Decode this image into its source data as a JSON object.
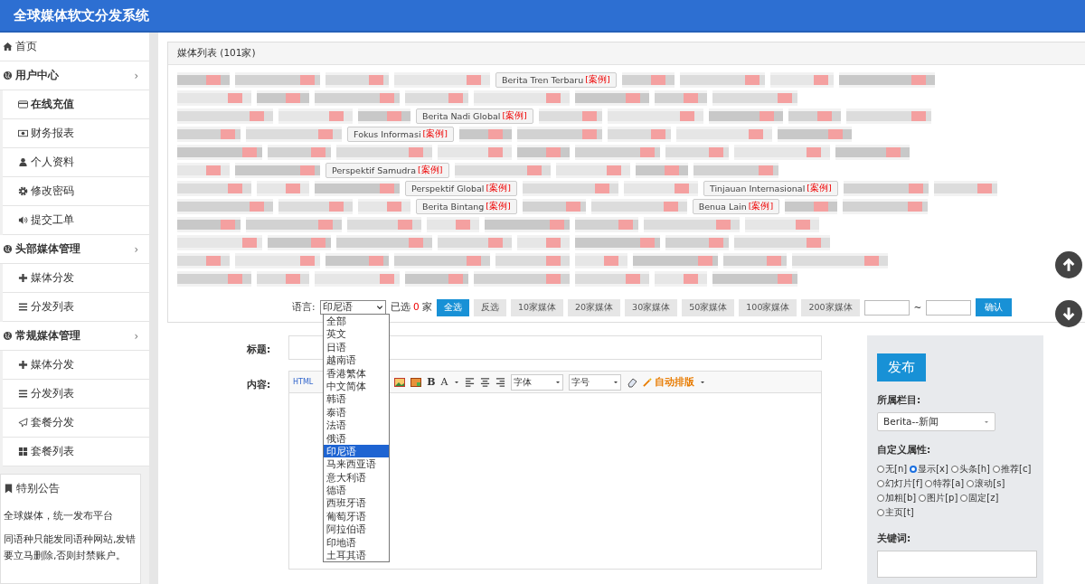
{
  "header": {
    "title": "全球媒体软文分发系统"
  },
  "sidebar": {
    "items": [
      {
        "kind": "top",
        "label": "首页"
      },
      {
        "kind": "group",
        "label": "用户中心",
        "chevron": "›"
      },
      {
        "kind": "sub",
        "label": "在线充值",
        "selected": true
      },
      {
        "kind": "sub",
        "label": "财务报表",
        "selected": false
      },
      {
        "kind": "sub",
        "label": "个人资料",
        "selected": false
      },
      {
        "kind": "sub",
        "label": "修改密码",
        "selected": false
      },
      {
        "kind": "sub",
        "label": "提交工单",
        "selected": false
      },
      {
        "kind": "group",
        "label": "头部媒体管理",
        "chevron": "›"
      },
      {
        "kind": "sub",
        "label": "媒体分发",
        "selected": false
      },
      {
        "kind": "sub",
        "label": "分发列表",
        "selected": false
      },
      {
        "kind": "group",
        "label": "常规媒体管理",
        "chevron": "›"
      },
      {
        "kind": "sub",
        "label": "媒体分发",
        "selected": false
      },
      {
        "kind": "sub",
        "label": "分发列表",
        "selected": false
      },
      {
        "kind": "sub",
        "label": "套餐分发",
        "selected": false
      },
      {
        "kind": "sub",
        "label": "套餐列表",
        "selected": false
      }
    ],
    "notice": {
      "title": "特别公告",
      "lines": [
        "全球媒体，统一发布平台",
        "同语种只能发同语种网站,发错要立马删除,否则封禁账户。"
      ]
    }
  },
  "media_panel": {
    "title": "媒体列表 (101家)",
    "rows": [
      [
        {
          "kind": "redacted"
        },
        {
          "kind": "redacted"
        },
        {
          "kind": "redacted"
        },
        {
          "kind": "redacted"
        },
        {
          "kind": "media",
          "name": "Berita Tren Terbaru",
          "tag": "[案例]"
        },
        {
          "kind": "redacted"
        },
        {
          "kind": "redacted"
        },
        {
          "kind": "redacted"
        },
        {
          "kind": "redacted"
        }
      ],
      [
        {
          "kind": "redacted"
        },
        {
          "kind": "redacted"
        },
        {
          "kind": "redacted"
        },
        {
          "kind": "redacted"
        },
        {
          "kind": "redacted"
        },
        {
          "kind": "redacted"
        },
        {
          "kind": "redacted"
        },
        {
          "kind": "redacted"
        }
      ],
      [
        {
          "kind": "redacted"
        },
        {
          "kind": "redacted"
        },
        {
          "kind": "redacted"
        },
        {
          "kind": "media",
          "name": "Berita Nadi Global",
          "tag": "[案例]"
        },
        {
          "kind": "redacted"
        },
        {
          "kind": "redacted"
        },
        {
          "kind": "redacted"
        },
        {
          "kind": "redacted"
        },
        {
          "kind": "redacted"
        }
      ],
      [
        {
          "kind": "redacted"
        },
        {
          "kind": "redacted"
        },
        {
          "kind": "media",
          "name": "Fokus Informasi",
          "tag": "[案例]"
        },
        {
          "kind": "redacted"
        },
        {
          "kind": "redacted"
        },
        {
          "kind": "redacted"
        },
        {
          "kind": "redacted"
        },
        {
          "kind": "redacted"
        }
      ],
      [
        {
          "kind": "redacted"
        },
        {
          "kind": "redacted"
        },
        {
          "kind": "redacted"
        },
        {
          "kind": "redacted"
        },
        {
          "kind": "redacted"
        },
        {
          "kind": "redacted"
        },
        {
          "kind": "redacted"
        },
        {
          "kind": "redacted"
        },
        {
          "kind": "redacted"
        }
      ],
      [
        {
          "kind": "redacted"
        },
        {
          "kind": "redacted"
        },
        {
          "kind": "media",
          "name": "Perspektif Samudra",
          "tag": "[案例]"
        },
        {
          "kind": "redacted"
        },
        {
          "kind": "redacted"
        },
        {
          "kind": "redacted"
        },
        {
          "kind": "redacted"
        }
      ],
      [
        {
          "kind": "redacted"
        },
        {
          "kind": "redacted"
        },
        {
          "kind": "redacted"
        },
        {
          "kind": "media",
          "name": "Perspektif Global",
          "tag": "[案例]"
        },
        {
          "kind": "redacted"
        },
        {
          "kind": "redacted"
        },
        {
          "kind": "media",
          "name": "Tinjauan Internasional",
          "tag": "[案例]"
        },
        {
          "kind": "redacted"
        },
        {
          "kind": "redacted"
        }
      ],
      [
        {
          "kind": "redacted"
        },
        {
          "kind": "redacted"
        },
        {
          "kind": "redacted"
        },
        {
          "kind": "media",
          "name": "Berita Bintang",
          "tag": "[案例]"
        },
        {
          "kind": "redacted"
        },
        {
          "kind": "redacted"
        },
        {
          "kind": "media",
          "name": "Benua Lain",
          "tag": "[案例]"
        },
        {
          "kind": "redacted"
        },
        {
          "kind": "redacted"
        }
      ],
      [
        {
          "kind": "redacted"
        },
        {
          "kind": "redacted"
        },
        {
          "kind": "redacted"
        },
        {
          "kind": "redacted"
        },
        {
          "kind": "redacted"
        },
        {
          "kind": "redacted"
        },
        {
          "kind": "redacted"
        },
        {
          "kind": "redacted"
        }
      ],
      [
        {
          "kind": "redacted"
        },
        {
          "kind": "redacted"
        },
        {
          "kind": "redacted"
        },
        {
          "kind": "redacted"
        },
        {
          "kind": "redacted"
        },
        {
          "kind": "redacted"
        },
        {
          "kind": "redacted"
        },
        {
          "kind": "redacted"
        }
      ],
      [
        {
          "kind": "redacted"
        },
        {
          "kind": "redacted"
        },
        {
          "kind": "redacted"
        },
        {
          "kind": "redacted"
        },
        {
          "kind": "redacted"
        },
        {
          "kind": "redacted"
        },
        {
          "kind": "redacted"
        },
        {
          "kind": "redacted"
        },
        {
          "kind": "redacted"
        }
      ],
      [
        {
          "kind": "redacted"
        },
        {
          "kind": "redacted"
        },
        {
          "kind": "redacted"
        },
        {
          "kind": "redacted"
        },
        {
          "kind": "redacted"
        },
        {
          "kind": "redacted"
        },
        {
          "kind": "redacted"
        },
        {
          "kind": "redacted"
        }
      ]
    ],
    "filter": {
      "label": "语言:",
      "language": "印尼语",
      "selected_prefix": "已选",
      "selected_count": "0",
      "selected_suffix": "家",
      "buttons": [
        {
          "label": "全选",
          "primary": true
        },
        {
          "label": "反选",
          "primary": false
        },
        {
          "label": "10家媒体",
          "primary": false
        },
        {
          "label": "20家媒体",
          "primary": false
        },
        {
          "label": "30家媒体",
          "primary": false
        },
        {
          "label": "50家媒体",
          "primary": false
        },
        {
          "label": "100家媒体",
          "primary": false
        },
        {
          "label": "200家媒体",
          "primary": false
        }
      ],
      "range_separator": "~",
      "confirm": "确认"
    },
    "language_options": [
      {
        "label": "全部",
        "selected": false
      },
      {
        "label": "英文",
        "selected": false
      },
      {
        "label": "日语",
        "selected": false
      },
      {
        "label": "越南语",
        "selected": false
      },
      {
        "label": "香港繁体",
        "selected": false
      },
      {
        "label": "中文简体",
        "selected": false
      },
      {
        "label": "韩语",
        "selected": false
      },
      {
        "label": "泰语",
        "selected": false
      },
      {
        "label": "法语",
        "selected": false
      },
      {
        "label": "俄语",
        "selected": false
      },
      {
        "label": "印尼语",
        "selected": true
      },
      {
        "label": "马来西亚语",
        "selected": false
      },
      {
        "label": "意大利语",
        "selected": false
      },
      {
        "label": "德语",
        "selected": false
      },
      {
        "label": "西班牙语",
        "selected": false
      },
      {
        "label": "葡萄牙语",
        "selected": false
      },
      {
        "label": "阿拉伯语",
        "selected": false
      },
      {
        "label": "印地语",
        "selected": false
      },
      {
        "label": "土耳其语",
        "selected": false
      }
    ]
  },
  "form": {
    "title_label": "标题:",
    "content_label": "内容:",
    "toolbar": {
      "html": "HTML",
      "bold": "B",
      "text_color_button": "A",
      "font": "字体",
      "size": "字号",
      "auto_format": "自动排版"
    }
  },
  "publish_panel": {
    "publish": "发布",
    "category_label": "所属栏目:",
    "category": "Berita--新闻",
    "attributes_label": "自定义属性:",
    "attributes": [
      {
        "label": "无[n]",
        "selected": false
      },
      {
        "label": "显示[x]",
        "selected": true
      },
      {
        "label": "头条[h]",
        "selected": false
      },
      {
        "label": "推荐[c]",
        "selected": false
      },
      {
        "label": "幻灯片[f]",
        "selected": false
      },
      {
        "label": "特荐[a]",
        "selected": false
      },
      {
        "label": "滚动[s]",
        "selected": false
      },
      {
        "label": "加粗[b]",
        "selected": false
      },
      {
        "label": "图片[p]",
        "selected": false
      },
      {
        "label": "固定[z]",
        "selected": false
      },
      {
        "label": "主页[t]",
        "selected": false
      }
    ],
    "keywords_label": "关键词:"
  }
}
